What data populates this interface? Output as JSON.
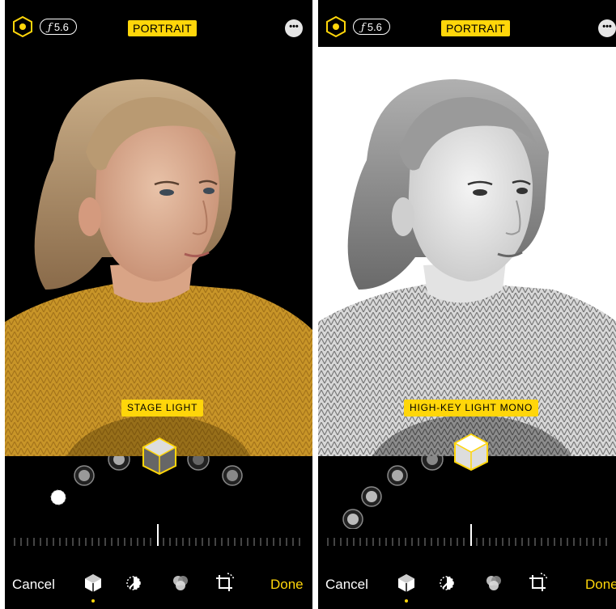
{
  "colors": {
    "accent": "#ffd60a",
    "background": "#000000"
  },
  "panels": [
    {
      "fstop": "5.6",
      "mode_label": "PORTRAIT",
      "lighting_label": "STAGE LIGHT",
      "cancel_label": "Cancel",
      "done_label": "Done",
      "photo_style": "color-stage-light"
    },
    {
      "fstop": "5.6",
      "mode_label": "PORTRAIT",
      "lighting_label": "HIGH-KEY LIGHT MONO",
      "cancel_label": "Cancel",
      "done_label": "Done",
      "photo_style": "high-key-mono"
    }
  ],
  "icons": [
    "live-photo-icon",
    "aperture-f-icon",
    "more-icon",
    "portrait-lighting-cube-icon",
    "adjust-dial-icon",
    "filters-icon",
    "crop-rotate-icon"
  ]
}
